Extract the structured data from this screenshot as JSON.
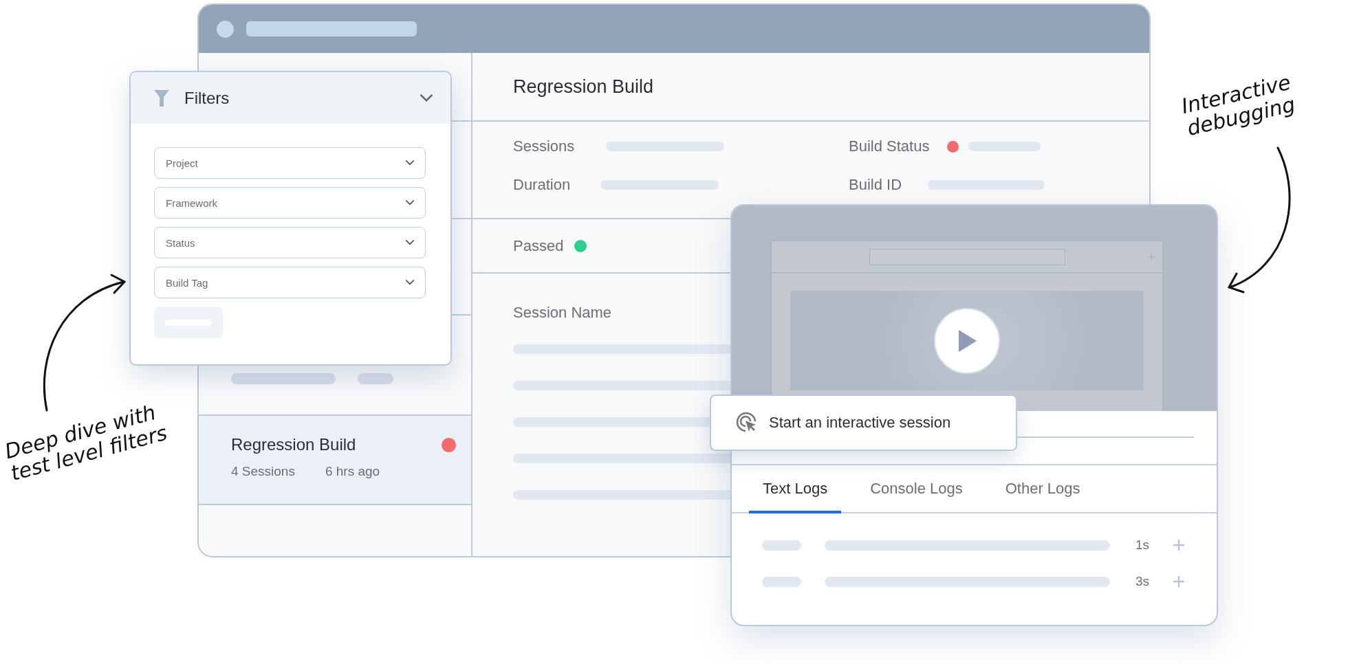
{
  "sidebar": {
    "items": [
      {
        "title": "Regression Build",
        "sessions": "4 Sessions",
        "time": "6 hrs ago",
        "color": "#f36b6b",
        "selected": true
      }
    ]
  },
  "build": {
    "title": "Regression Build",
    "info": [
      {
        "label": "Sessions"
      },
      {
        "label": "Build Status",
        "color": "#f36b6b"
      },
      {
        "label": "Duration"
      },
      {
        "label": "Build ID"
      }
    ],
    "result": {
      "label": "Passed",
      "color": "#2ecf8e"
    },
    "session_heading": "Session Name"
  },
  "filters": {
    "title": "Filters",
    "fields": [
      {
        "placeholder": "Project"
      },
      {
        "placeholder": "Framework"
      },
      {
        "placeholder": "Status"
      },
      {
        "placeholder": "Build Tag"
      }
    ]
  },
  "session_card": {
    "action": "Start an interactive session",
    "tabs": [
      {
        "label": "Text Logs",
        "selected": true
      },
      {
        "label": "Console Logs",
        "selected": false
      },
      {
        "label": "Other Logs",
        "selected": false
      }
    ],
    "logs": [
      {
        "time": "1s"
      },
      {
        "time": "3s"
      }
    ]
  },
  "annotations": [
    {
      "text": "Deep dive with\ntest level filters",
      "kind": "left"
    },
    {
      "text": "Interactive\ndebugging",
      "kind": "right"
    }
  ]
}
